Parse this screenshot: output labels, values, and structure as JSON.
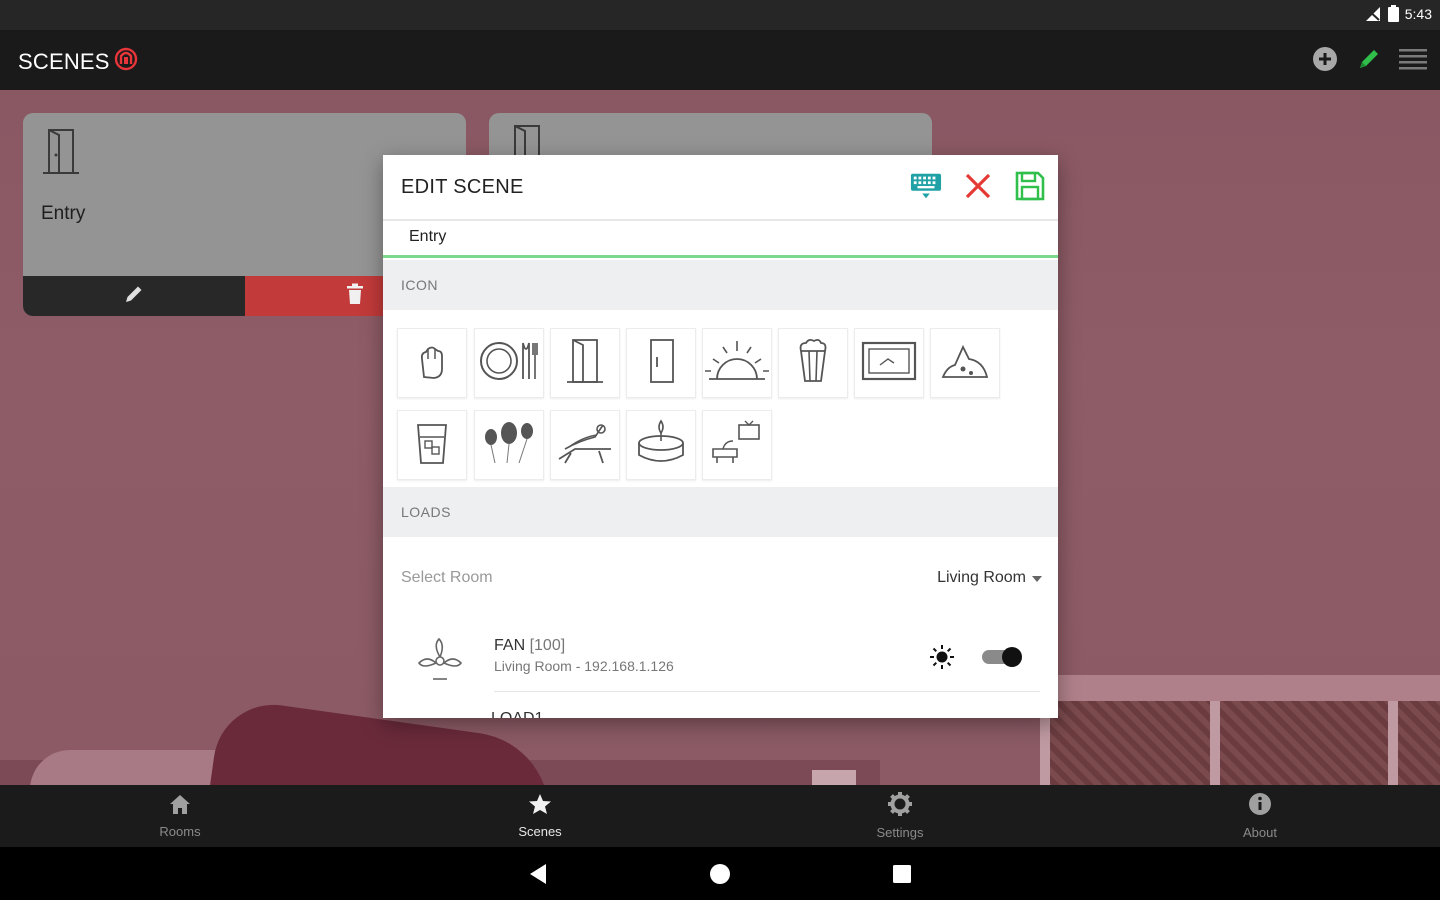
{
  "status_bar": {
    "time": "5:43",
    "icons": [
      "signal-icon",
      "battery-icon"
    ]
  },
  "app_bar": {
    "title": "SCENES",
    "actions": [
      "add-icon",
      "edit-pencil-icon",
      "menu-icon"
    ],
    "accent": "#e8353a"
  },
  "scene_cards": [
    {
      "name": "Entry",
      "icon": "door-icon"
    },
    {
      "name": "",
      "icon": "door-icon"
    }
  ],
  "dialog": {
    "title": "EDIT SCENE",
    "actions": [
      "keyboard-icon",
      "close-icon",
      "save-icon"
    ],
    "name_value": "Entry",
    "icon_section": "ICON",
    "icons": [
      "hand-icon",
      "dining-icon",
      "door-open-icon",
      "door-closed-icon",
      "sunrise-icon",
      "popcorn-icon",
      "picture-frame-icon",
      "mountain-icon",
      "glass-icon",
      "balloons-icon",
      "lounge-chair-icon",
      "candle-icon",
      "tv-sofa-icon"
    ],
    "loads_section": "LOADS",
    "select_room_label": "Select Room",
    "room_value": "Living Room",
    "loads": [
      {
        "name": "FAN",
        "id": "[100]",
        "detail": "Living Room - 192.168.1.126",
        "icon": "fan-icon",
        "on": true
      }
    ],
    "next_load_partial": "LOAD1"
  },
  "bottom_nav": {
    "items": [
      {
        "label": "Rooms",
        "icon": "home-icon",
        "active": false
      },
      {
        "label": "Scenes",
        "icon": "star-icon",
        "active": true
      },
      {
        "label": "Settings",
        "icon": "gear-icon",
        "active": false
      },
      {
        "label": "About",
        "icon": "info-icon",
        "active": false
      }
    ]
  },
  "colors": {
    "save_green": "#2fbf4a",
    "close_red": "#e53935",
    "keyboard_teal": "#1fa1a6",
    "delete_red": "#c23a3a",
    "underline_green": "#7bd88c"
  }
}
